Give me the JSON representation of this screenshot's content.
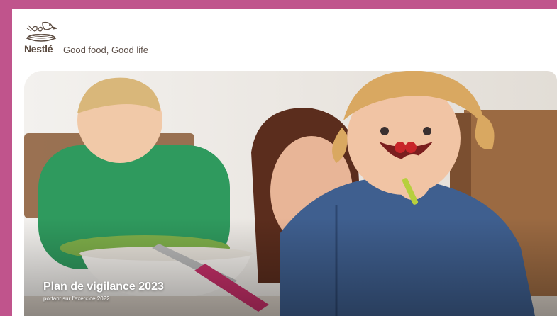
{
  "brand": {
    "wordmark": "Nestlé",
    "tagline": "Good food, Good life",
    "logo_icon": "nest-with-birds-icon",
    "accent": "#c0548c"
  },
  "cover": {
    "title": "Plan de vigilance 2023",
    "subtitle": "portant sur l'exercice 2022"
  }
}
